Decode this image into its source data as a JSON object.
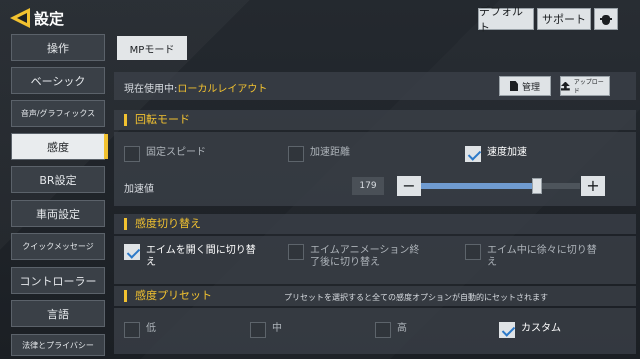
{
  "window": {
    "title": "設定"
  },
  "top_buttons": {
    "default": "デフォルト",
    "support": "サポート",
    "bug_icon": "bug-icon"
  },
  "sidebar": {
    "items": [
      {
        "label": "操作"
      },
      {
        "label": "ベーシック"
      },
      {
        "label": "音声/グラフィックス"
      },
      {
        "label": "感度"
      },
      {
        "label": "BR設定"
      },
      {
        "label": "車両設定"
      },
      {
        "label": "クイックメッセージ"
      },
      {
        "label": "コントローラー"
      },
      {
        "label": "言語"
      },
      {
        "label": "法律とプライバシー"
      }
    ],
    "active_label": "感度"
  },
  "tab": {
    "label": "MPモード"
  },
  "current_layout": {
    "label": "現在使用中:",
    "value": "ローカルレイアウト",
    "manage": "管理",
    "upload": "アップロード"
  },
  "rotation": {
    "title": "回転モード",
    "options": [
      {
        "label": "固定スピード",
        "checked": false
      },
      {
        "label": "加速距離",
        "checked": false
      },
      {
        "label": "速度加速",
        "checked": true
      }
    ],
    "accel_label": "加速値",
    "accel_value": "179",
    "accel_level": 0.73,
    "minus": "−",
    "plus": "+"
  },
  "sensitivity_switch": {
    "title": "感度切り替え",
    "options": [
      {
        "line1": "エイムを開く間に切り替",
        "line2": "え",
        "checked": true
      },
      {
        "line1": "エイムアニメーション終",
        "line2": "了後に切り替え",
        "checked": false
      },
      {
        "line1": "エイム中に徐々に切り替",
        "line2": "え",
        "checked": false
      }
    ]
  },
  "preset": {
    "title": "感度プリセット",
    "note": "プリセットを選択すると全ての感度オプションが自動的にセットされます",
    "options": [
      {
        "label": "低",
        "checked": false
      },
      {
        "label": "中",
        "checked": false
      },
      {
        "label": "高",
        "checked": false
      },
      {
        "label": "カスタム",
        "checked": true
      }
    ]
  },
  "colors": {
    "accent": "#f2c230",
    "check": "#2c79c8",
    "slider": "#6f9bd0"
  }
}
